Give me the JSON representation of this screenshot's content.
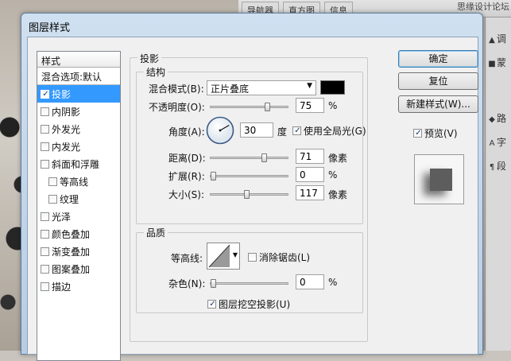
{
  "top_panel": {
    "tabs": [
      "导航器",
      "直方图",
      "信息"
    ],
    "watermark": "思缘设计论坛",
    "right_strip": [
      {
        "icon": "triangle-icon",
        "label": "调"
      },
      {
        "icon": "square-icon",
        "label": "蒙"
      },
      {
        "icon": "path-icon",
        "label": "路"
      },
      {
        "icon": "type-icon",
        "label": "字"
      },
      {
        "icon": "paragraph-icon",
        "label": "段"
      }
    ]
  },
  "dialog": {
    "title": "图层样式",
    "styles_header": "样式",
    "blend_options": "混合选项:默认",
    "styles": [
      {
        "label": "投影",
        "checked": true,
        "selected": true,
        "sub": false
      },
      {
        "label": "内阴影",
        "checked": false,
        "selected": false,
        "sub": false
      },
      {
        "label": "外发光",
        "checked": false,
        "selected": false,
        "sub": false
      },
      {
        "label": "内发光",
        "checked": false,
        "selected": false,
        "sub": false
      },
      {
        "label": "斜面和浮雕",
        "checked": false,
        "selected": false,
        "sub": false
      },
      {
        "label": "等高线",
        "checked": false,
        "selected": false,
        "sub": true
      },
      {
        "label": "纹理",
        "checked": false,
        "selected": false,
        "sub": true
      },
      {
        "label": "光泽",
        "checked": false,
        "selected": false,
        "sub": false
      },
      {
        "label": "颜色叠加",
        "checked": false,
        "selected": false,
        "sub": false
      },
      {
        "label": "渐变叠加",
        "checked": false,
        "selected": false,
        "sub": false
      },
      {
        "label": "图案叠加",
        "checked": false,
        "selected": false,
        "sub": false
      },
      {
        "label": "描边",
        "checked": false,
        "selected": false,
        "sub": false
      }
    ],
    "panel_title": "投影",
    "structure": {
      "title": "结构",
      "blend_mode_label": "混合模式(B):",
      "blend_mode_value": "正片叠底",
      "shadow_color": "#000000",
      "opacity_label": "不透明度(O):",
      "opacity_value": "75",
      "opacity_unit": "%",
      "opacity_level": 0.75,
      "angle_label": "角度(A):",
      "angle_value": "30",
      "angle_unit": "度",
      "global_light_label": "使用全局光(G)",
      "global_light_checked": true,
      "distance_label": "距离(D):",
      "distance_value": "71",
      "distance_unit": "像素",
      "distance_level": 0.71,
      "spread_label": "扩展(R):",
      "spread_value": "0",
      "spread_unit": "%",
      "spread_level": 0,
      "size_label": "大小(S):",
      "size_value": "117",
      "size_unit": "像素",
      "size_level": 0.47
    },
    "quality": {
      "title": "品质",
      "contour_label": "等高线:",
      "antialias_label": "消除锯齿(L)",
      "antialias_checked": false,
      "noise_label": "杂色(N):",
      "noise_value": "0",
      "noise_unit": "%",
      "noise_level": 0,
      "knockout_label": "图层挖空投影(U)",
      "knockout_checked": true
    },
    "buttons": {
      "ok": "确定",
      "reset": "复位",
      "new_style": "新建样式(W)...",
      "preview_label": "预览(V)",
      "preview_checked": true
    }
  }
}
